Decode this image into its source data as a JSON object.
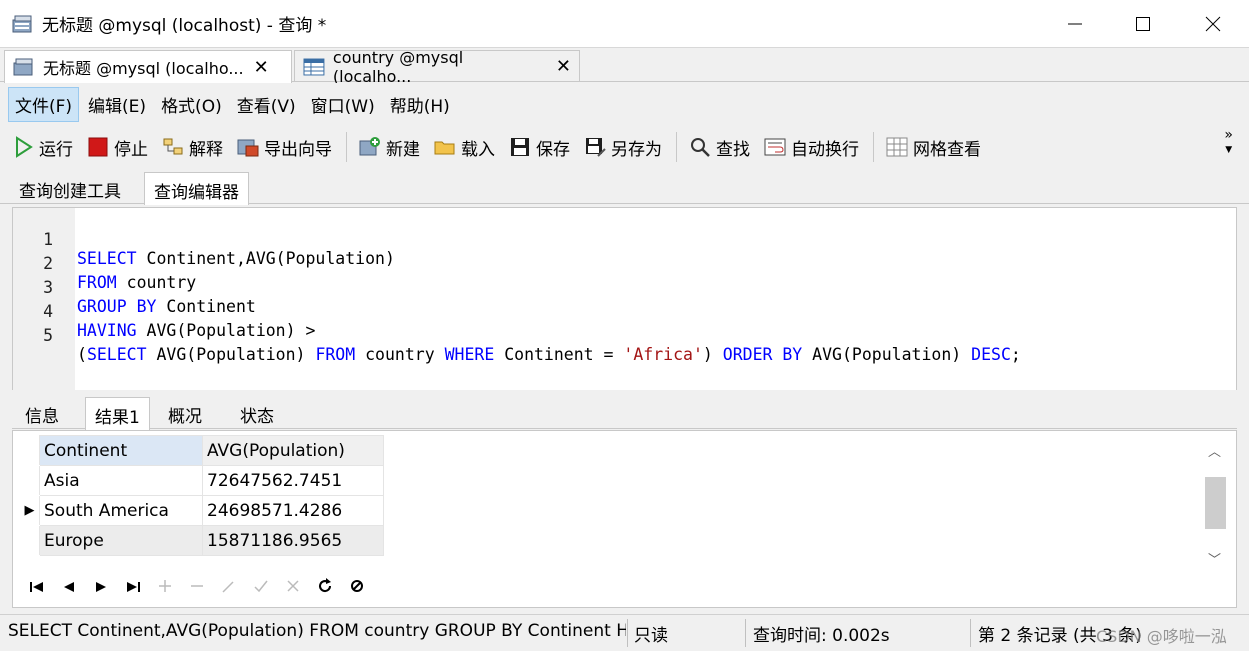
{
  "window": {
    "title": "无标题 @mysql (localhost) - 查询 *",
    "minimize": "—",
    "maximize": "☐",
    "close": "✕"
  },
  "doc_tabs": [
    {
      "label": "无标题 @mysql (localho...",
      "close": "✕"
    },
    {
      "label": "country @mysql (localho...",
      "close": "✕"
    }
  ],
  "menu": {
    "items": [
      "文件(F)",
      "编辑(E)",
      "格式(O)",
      "查看(V)",
      "窗口(W)",
      "帮助(H)"
    ]
  },
  "toolbar": {
    "run": "运行",
    "stop": "停止",
    "explain": "解释",
    "export_wizard": "导出向导",
    "new": "新建",
    "load": "载入",
    "save": "保存",
    "save_as": "另存为",
    "find": "查找",
    "word_wrap": "自动换行",
    "grid_view": "网格查看",
    "overflow": "»"
  },
  "query_tabs": [
    "查询创建工具",
    "查询编辑器"
  ],
  "editor": {
    "line_numbers": [
      "1",
      "2",
      "3",
      "4",
      "5"
    ]
  },
  "result_tabs": [
    "信息",
    "结果1",
    "概况",
    "状态"
  ],
  "result_grid": {
    "columns": [
      "Continent",
      "AVG(Population)"
    ],
    "rows": [
      [
        "Asia",
        "72647562.7451"
      ],
      [
        "South America",
        "24698571.4286"
      ],
      [
        "Europe",
        "15871186.9565"
      ]
    ],
    "current_row_marker": "▶"
  },
  "status": {
    "sql": "SELECT Continent,AVG(Population)  FROM country  GROUP BY Continent  HAVING",
    "mode": "只读",
    "query_time": "查询时间: 0.002s",
    "record": "第 2 条记录 (共 3 条)",
    "watermark": "CSDN @哆啦一泓"
  },
  "colors": {
    "keyword": "#0000ff",
    "string": "#a31515",
    "menu_active_bg": "#cce4f7",
    "run_icon": "#2e9e3c",
    "stop_icon": "#d01818"
  }
}
